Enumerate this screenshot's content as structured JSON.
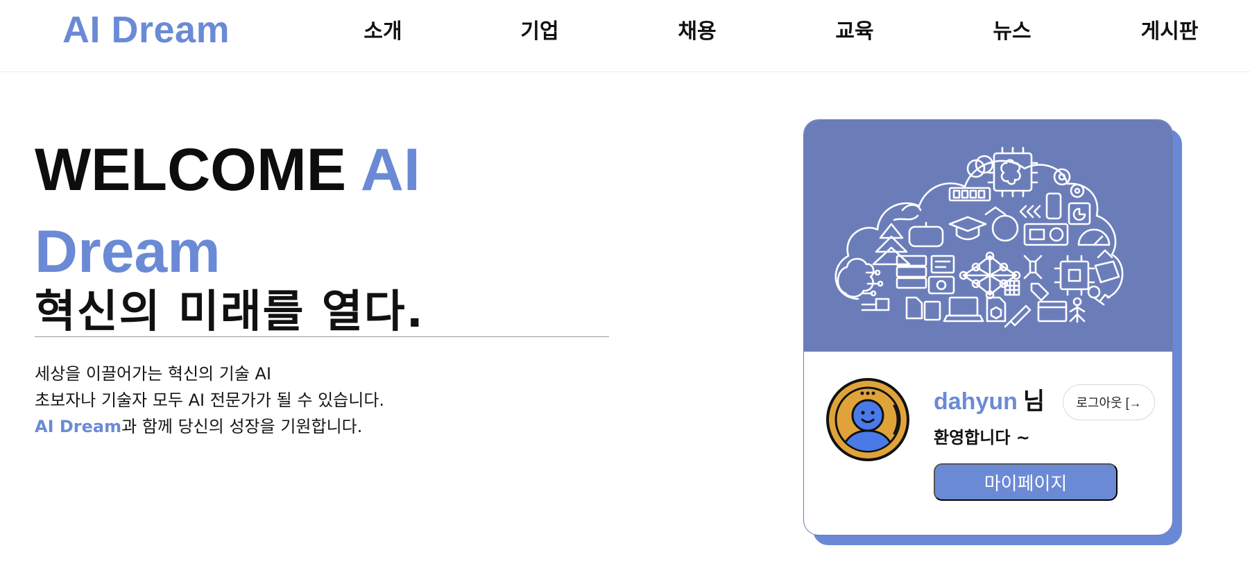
{
  "header": {
    "logo": "AI Dream",
    "nav": [
      {
        "label": "소개"
      },
      {
        "label": "기업"
      },
      {
        "label": "채용"
      },
      {
        "label": "교육"
      },
      {
        "label": "뉴스"
      },
      {
        "label": "게시판"
      }
    ]
  },
  "hero": {
    "title_prefix": "WELCOME ",
    "title_accent_1": "AI",
    "title_accent_2": "Dream",
    "subtitle": "혁신의 미래를 열다.",
    "desc_line1": "세상을 이끌어가는 혁신의 기술 AI",
    "desc_line2": "초보자나 기술자 모두 AI 전문가가 될 수 있습니다.",
    "desc_brand": "AI Dream",
    "desc_line3_rest": "과 함께 당신의 성장을 기원합니다."
  },
  "profile_card": {
    "username": "dahyun",
    "honorific": "님",
    "welcome": "환영합니다 ~",
    "logout_label": "로그아웃 [→",
    "mypage_label": "마이페이지"
  },
  "colors": {
    "accent": "#6b8ad6",
    "card_banner": "#6b7db9",
    "avatar_ring": "#e0a33a",
    "avatar_person": "#4a7ae8"
  },
  "icons": [
    "ai-technology-cloud-illustration",
    "user-avatar-icon",
    "logout-arrow-icon"
  ]
}
